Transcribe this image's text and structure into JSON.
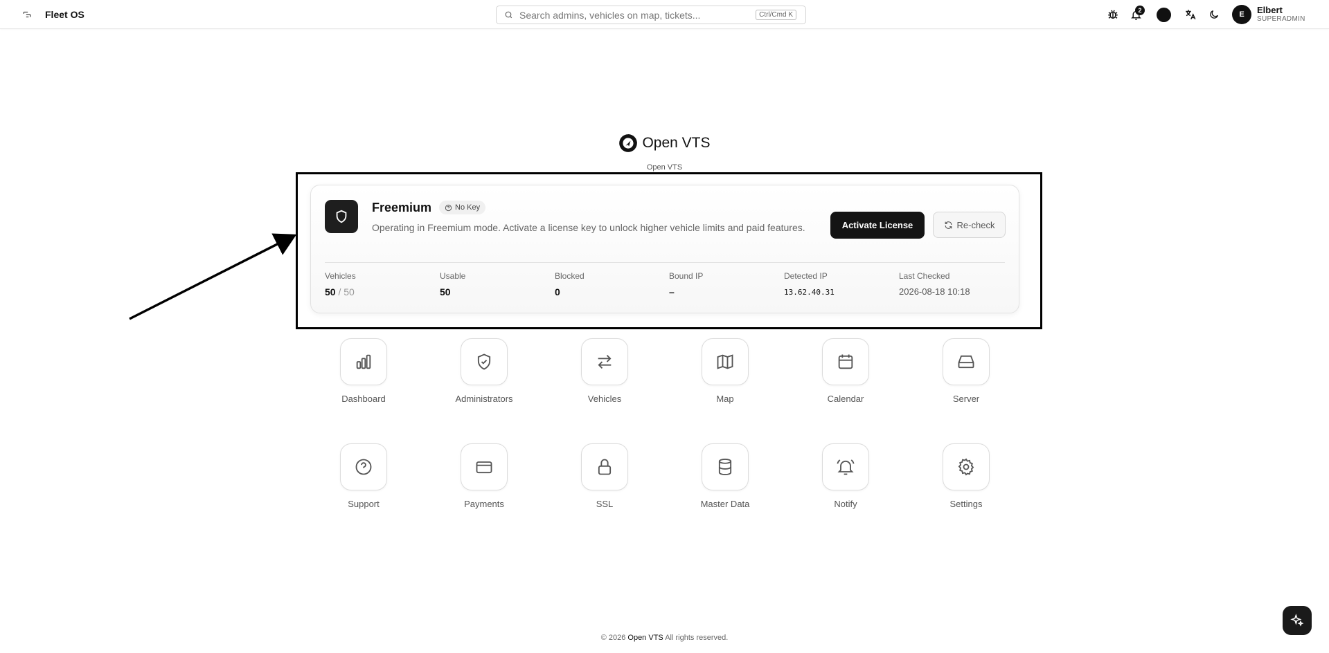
{
  "header": {
    "brand": "Fleet OS",
    "search_placeholder": "Search admins, vehicles on map, tickets...",
    "search_shortcut": "Ctrl/Cmd K",
    "notification_count": "2",
    "user": {
      "initial": "E",
      "name": "Elbert",
      "role": "SUPERADMIN"
    }
  },
  "logo": {
    "name": "Open VTS",
    "subtitle": "Open VTS"
  },
  "license": {
    "plan": "Freemium",
    "key_badge": "No Key",
    "description": "Operating in Freemium mode. Activate a license key to unlock higher vehicle limits and paid features.",
    "activate_label": "Activate License",
    "recheck_label": "Re-check",
    "stats": {
      "vehicles": {
        "label": "Vehicles",
        "used": "50",
        "total": "/ 50"
      },
      "usable": {
        "label": "Usable",
        "value": "50"
      },
      "blocked": {
        "label": "Blocked",
        "value": "0"
      },
      "bound_ip": {
        "label": "Bound IP",
        "value": "–"
      },
      "detected_ip": {
        "label": "Detected IP",
        "value": "13.62.40.31"
      },
      "last_checked": {
        "label": "Last Checked",
        "value": "2026-08-18 10:18"
      }
    }
  },
  "tiles": [
    {
      "label": "Dashboard",
      "icon": "bar-chart-icon"
    },
    {
      "label": "Administrators",
      "icon": "shield-check-icon"
    },
    {
      "label": "Vehicles",
      "icon": "swap-arrows-icon"
    },
    {
      "label": "Map",
      "icon": "map-icon"
    },
    {
      "label": "Calendar",
      "icon": "calendar-icon"
    },
    {
      "label": "Server",
      "icon": "hard-drive-icon"
    },
    {
      "label": "Support",
      "icon": "help-circle-icon"
    },
    {
      "label": "Payments",
      "icon": "credit-card-icon"
    },
    {
      "label": "SSL",
      "icon": "lock-icon"
    },
    {
      "label": "Master Data",
      "icon": "database-icon"
    },
    {
      "label": "Notify",
      "icon": "bell-ring-icon"
    },
    {
      "label": "Settings",
      "icon": "gear-icon"
    }
  ],
  "footer": {
    "prefix": "© 2026",
    "brand": "Open VTS",
    "suffix": "All rights reserved."
  }
}
